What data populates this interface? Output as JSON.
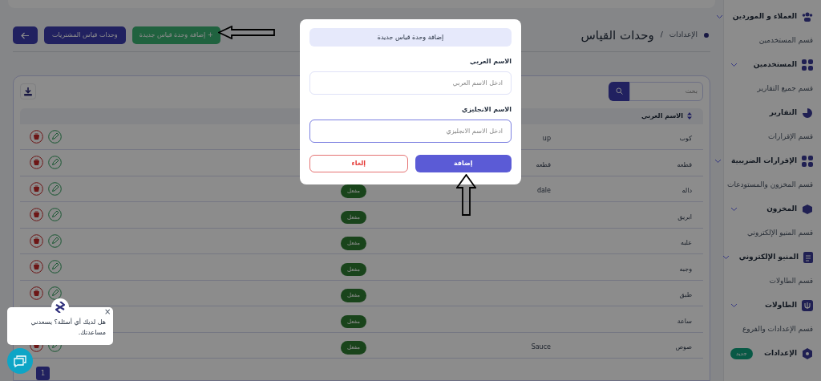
{
  "page": {
    "title": "وحدات القياس",
    "breadcrumb": "الإعدادات",
    "separator": "/"
  },
  "toolbar": {
    "add_button": "+ إضافة وحدة قياس جديدة",
    "purchase_units_button": "وحدات قياس المشتريات"
  },
  "search": {
    "placeholder": "بحث"
  },
  "table": {
    "columns": [
      "الاسم العربي"
    ],
    "rows": [
      {
        "arabic_name": "كوب",
        "english_name": "up",
        "actions": true
      },
      {
        "arabic_name": "قطعه",
        "english_name": "قطعه",
        "actions": true
      },
      {
        "arabic_name": "داله",
        "english_name": "dale",
        "status": "مفعل",
        "actions": true
      },
      {
        "arabic_name": "ابريق",
        "status": "مفعل",
        "actions": true
      },
      {
        "arabic_name": "علبه",
        "status": "مفعل",
        "actions": true
      },
      {
        "arabic_name": "وجبه",
        "status": "مفعل",
        "actions": true
      },
      {
        "arabic_name": "طبق",
        "status": "مفعل",
        "actions": true
      },
      {
        "arabic_name": "ساعة",
        "status": "مفعل",
        "actions": false
      },
      {
        "arabic_name": "صوص",
        "english_name": "Sauce",
        "status": "مفعل",
        "actions": true
      }
    ]
  },
  "pagination": {
    "pages": [
      {
        "label": "1",
        "selected": true
      }
    ]
  },
  "sidebar": {
    "items": [
      {
        "kind": "item",
        "label": "العملاء و الموردين",
        "chevron": true
      },
      {
        "kind": "section",
        "label": "قسم المستخدمين"
      },
      {
        "kind": "item",
        "label": "المستخدمين",
        "chevron": true
      },
      {
        "kind": "section",
        "label": "قسم جميع التقارير"
      },
      {
        "kind": "item",
        "label": "التقارير",
        "chevron": false
      },
      {
        "kind": "section",
        "label": "قسم الإقرارات"
      },
      {
        "kind": "item",
        "label": "الإقرارات الضريبية",
        "chevron": true
      },
      {
        "kind": "section",
        "label": "قسم المخزون والمستودعات"
      },
      {
        "kind": "item",
        "label": "المخزون",
        "chevron": true
      },
      {
        "kind": "section",
        "label": "قسم المنيو الإلكتروني"
      },
      {
        "kind": "item",
        "label": "المنيو الإلكتروني",
        "chevron": true
      },
      {
        "kind": "section",
        "label": "قسم الطاولات"
      },
      {
        "kind": "item",
        "label": "الطاولات",
        "chevron": true
      },
      {
        "kind": "section",
        "label": "قسم الإعدادات والفروع"
      },
      {
        "kind": "item",
        "label": "الإعدادات",
        "chevron": false,
        "badge": "جديد"
      }
    ]
  },
  "modal": {
    "title": "إضافة وحدة قياس جديدة",
    "fields": [
      {
        "label": "الاسم العربي",
        "placeholder": "ادخل الاسم العربي",
        "focused": false
      },
      {
        "label": "الاسم الانجليزي",
        "placeholder": "ادخل الاسم الانجليزي",
        "focused": true
      }
    ],
    "cancel_button": "إلغاء",
    "submit_button": "إضافة"
  },
  "chat": {
    "message": "هل لديك أي أسئلة؟ يسعدني مساعدتك.",
    "close": "×"
  }
}
